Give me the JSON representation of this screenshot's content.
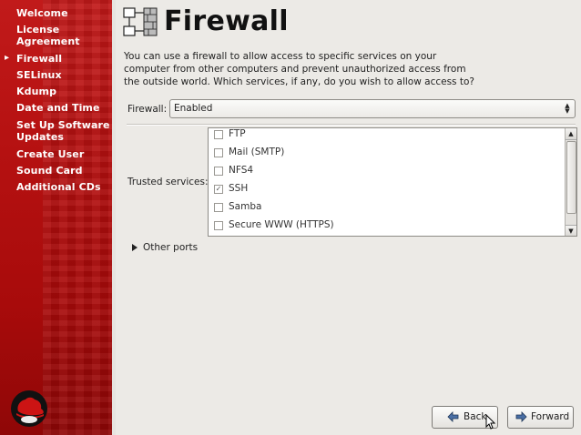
{
  "sidebar": {
    "steps": [
      "Welcome",
      "License Agreement",
      "Firewall",
      "SELinux",
      "Kdump",
      "Date and Time",
      "Set Up Software Updates",
      "Create User",
      "Sound Card",
      "Additional CDs"
    ],
    "current": "Firewall"
  },
  "header": {
    "title": "Firewall",
    "icon": "firewall-network-icon"
  },
  "intro": "You can use a firewall to allow access to specific services on your computer from other computers and prevent unauthorized access from the outside world.  Which services, if any, do you wish to allow access to?",
  "firewall": {
    "label": "Firewall:",
    "value": "Enabled"
  },
  "trusted_services": {
    "label": "Trusted services:",
    "items": [
      {
        "name": "FTP",
        "checked": false
      },
      {
        "name": "Mail (SMTP)",
        "checked": false
      },
      {
        "name": "NFS4",
        "checked": false
      },
      {
        "name": "SSH",
        "checked": true
      },
      {
        "name": "Samba",
        "checked": false
      },
      {
        "name": "Secure WWW (HTTPS)",
        "checked": false
      }
    ]
  },
  "other_ports": {
    "label": "Other ports"
  },
  "buttons": {
    "back": "Back",
    "forward": "Forward"
  }
}
